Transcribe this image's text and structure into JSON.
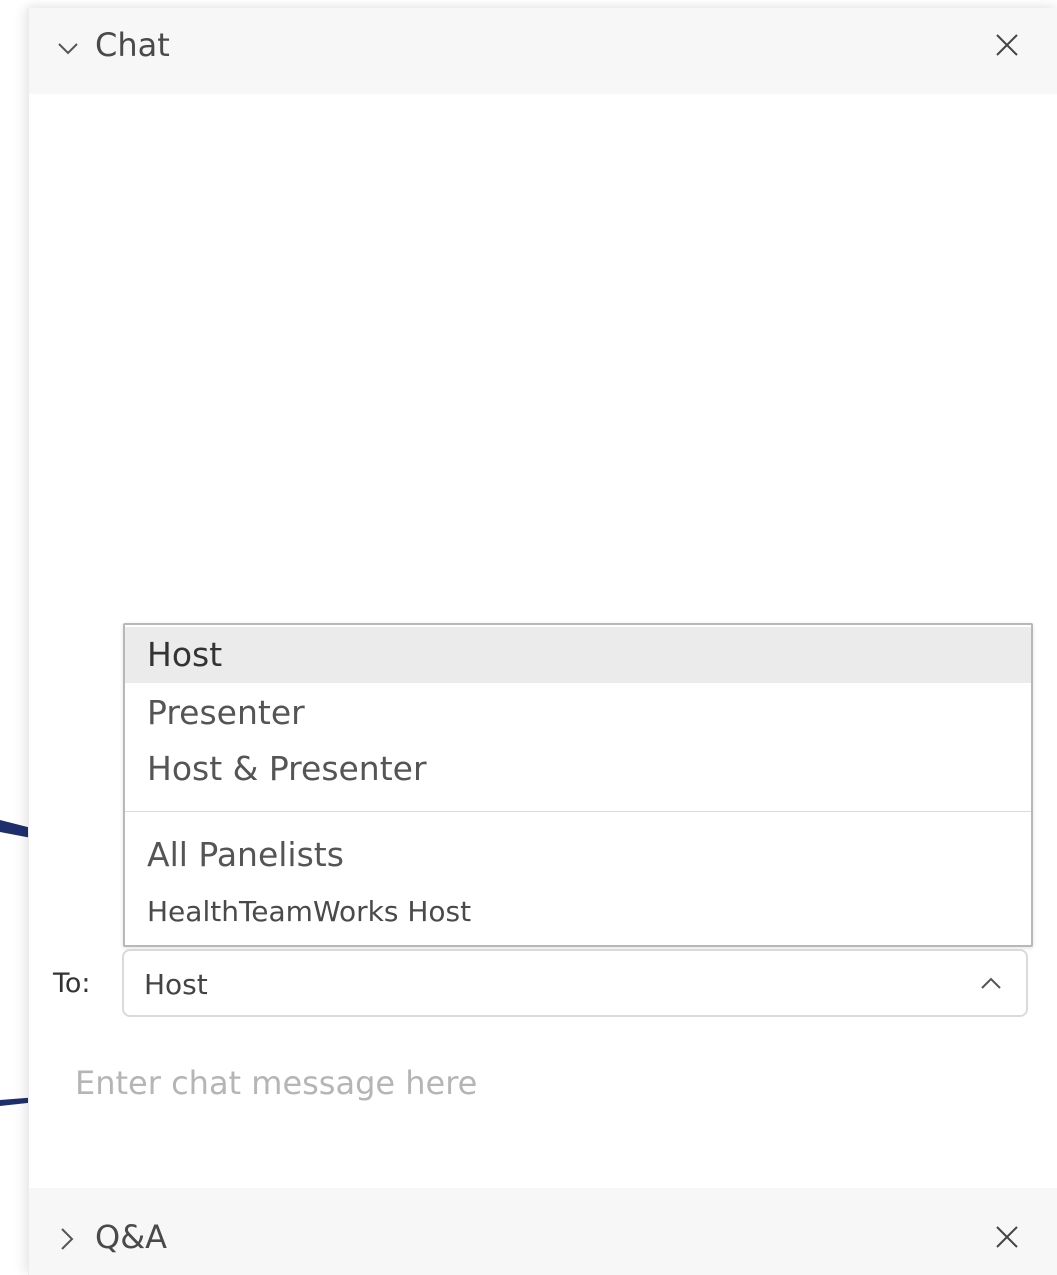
{
  "chat_panel": {
    "title": "Chat",
    "expand_icon": "chevron-down-icon",
    "close_icon": "close-icon"
  },
  "recipient_dropdown": {
    "options": [
      {
        "label": "Host",
        "selected": true
      },
      {
        "label": "Presenter",
        "selected": false
      },
      {
        "label": "Host & Presenter",
        "selected": false
      },
      {
        "label": "All Panelists",
        "selected": false
      },
      {
        "label": "HealthTeamWorks Host",
        "selected": false
      }
    ]
  },
  "to_field": {
    "label": "To:",
    "value": "Host",
    "caret_icon": "chevron-up-icon"
  },
  "chat_input": {
    "placeholder": "Enter chat message here",
    "value": ""
  },
  "qa_panel": {
    "title": "Q&A",
    "expand_icon": "chevron-right-icon",
    "close_icon": "close-icon"
  },
  "colors": {
    "header_bg": "#f7f7f7",
    "selected_option_bg": "#ebebeb",
    "callout_line": "#1f2f6e",
    "placeholder": "#b5b5b5"
  }
}
